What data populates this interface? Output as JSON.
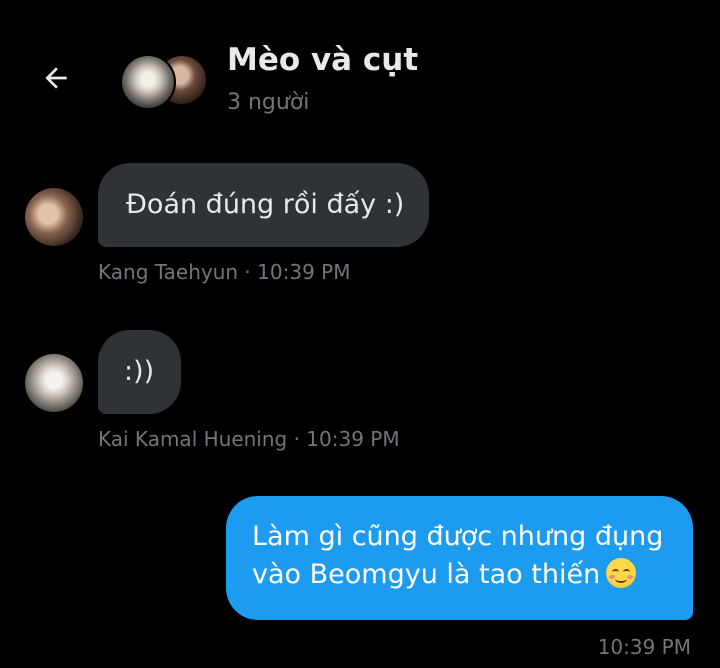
{
  "header": {
    "back_icon": "arrow-left-icon",
    "title": "Mèo và cụt",
    "subtitle": "3 người"
  },
  "colors": {
    "background": "#000000",
    "received_bubble": "#2f3336",
    "sent_bubble": "#1d9bf0",
    "secondary_text": "#71767b"
  },
  "messages": [
    {
      "direction": "received",
      "text": "Đoán đúng rồi đấy :)",
      "meta": "Kang Taehyun · 10:39 PM"
    },
    {
      "direction": "received",
      "text": ":))",
      "meta": "Kai Kamal Huening · 10:39 PM"
    },
    {
      "direction": "sent",
      "text_line1": "Làm gì cũng được nhưng đụng",
      "text_line2": "vào Beomgyu là tao thiến",
      "emoji": "☺️",
      "meta": "10:39 PM"
    }
  ]
}
